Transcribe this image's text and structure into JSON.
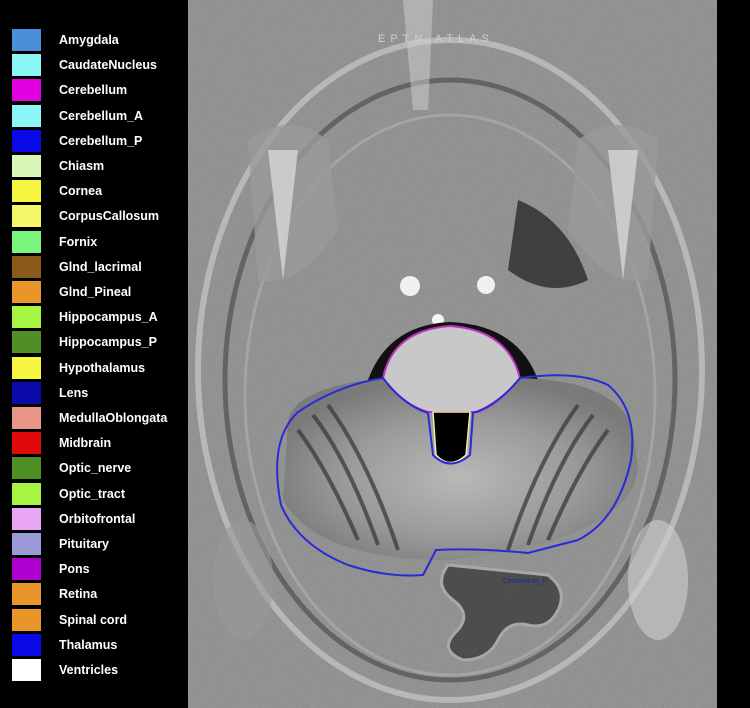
{
  "legend": {
    "items": [
      {
        "label": "Amygdala",
        "color": "#4a8fd8"
      },
      {
        "label": "CaudateNucleus",
        "color": "#8cf5f5"
      },
      {
        "label": "Cerebellum",
        "color": "#e000e0"
      },
      {
        "label": "Cerebellum_A",
        "color": "#8cf5f5"
      },
      {
        "label": "Cerebellum_P",
        "color": "#0a0ae8"
      },
      {
        "label": "Chiasm",
        "color": "#d9f7b6"
      },
      {
        "label": "Cornea",
        "color": "#f5f542"
      },
      {
        "label": "CorpusCallosum",
        "color": "#f5f56a"
      },
      {
        "label": "Fornix",
        "color": "#7cf57c"
      },
      {
        "label": "Glnd_lacrimal",
        "color": "#8a5a1a"
      },
      {
        "label": "Glnd_Pineal",
        "color": "#e8962a"
      },
      {
        "label": "Hippocampus_A",
        "color": "#a6f542"
      },
      {
        "label": "Hippocampus_P",
        "color": "#4f8f26"
      },
      {
        "label": "Hypothalamus",
        "color": "#f5f542"
      },
      {
        "label": "Lens",
        "color": "#0a0aa8"
      },
      {
        "label": "MedullaOblongata",
        "color": "#e8968a"
      },
      {
        "label": "Midbrain",
        "color": "#e00a0a"
      },
      {
        "label": "Optic_nerve",
        "color": "#4f8f26"
      },
      {
        "label": "Optic_tract",
        "color": "#a6f542"
      },
      {
        "label": "Orbitofrontal",
        "color": "#e8a6f5"
      },
      {
        "label": "Pituitary",
        "color": "#9a9ad8"
      },
      {
        "label": "Pons",
        "color": "#b000d0"
      },
      {
        "label": "Retina",
        "color": "#e8962a"
      },
      {
        "label": "Spinal cord",
        "color": "#e8962a"
      },
      {
        "label": "Thalamus",
        "color": "#0a0ae8"
      },
      {
        "label": "Ventricles",
        "color": "#ffffff"
      }
    ]
  },
  "viewer": {
    "watermark": "EPTN ATLAS",
    "structure_label": "Cerebellum_P",
    "contours": {
      "cerebellum_color": "#2a2ad8",
      "pons_color": "#c030c0"
    }
  }
}
